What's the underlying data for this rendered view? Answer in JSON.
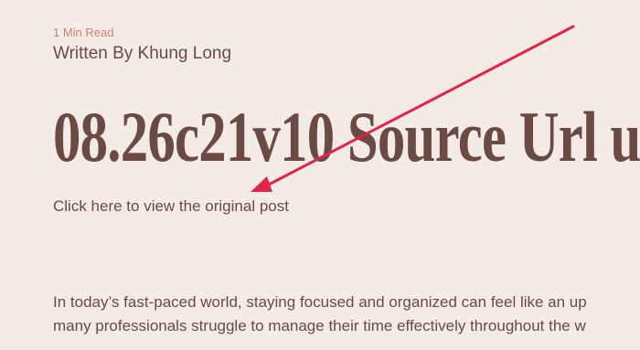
{
  "meta": {
    "read_time": "1 Min Read",
    "byline": "Written By Khung Long"
  },
  "article": {
    "title": "08.26c21v10 Source Url u",
    "original_link_text": "Click here to view the original post",
    "body_lines": [
      "In today’s fast-paced world, staying focused and organized can feel like an up",
      "many professionals struggle to manage their time effectively throughout the w"
    ]
  },
  "colors": {
    "background": "#f5ebe6",
    "text": "#6b4a45",
    "accent": "#d47f6c",
    "annotation_arrow": "#e0244a"
  }
}
